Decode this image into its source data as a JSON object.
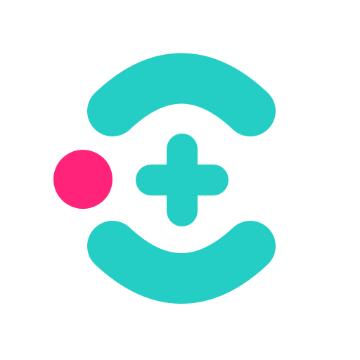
{
  "logo": {
    "icon_name": "medical-cross-logo-icon",
    "colors": {
      "teal": "#25CEC5",
      "pink": "#FF2379",
      "background": "#FFFFFF"
    }
  }
}
